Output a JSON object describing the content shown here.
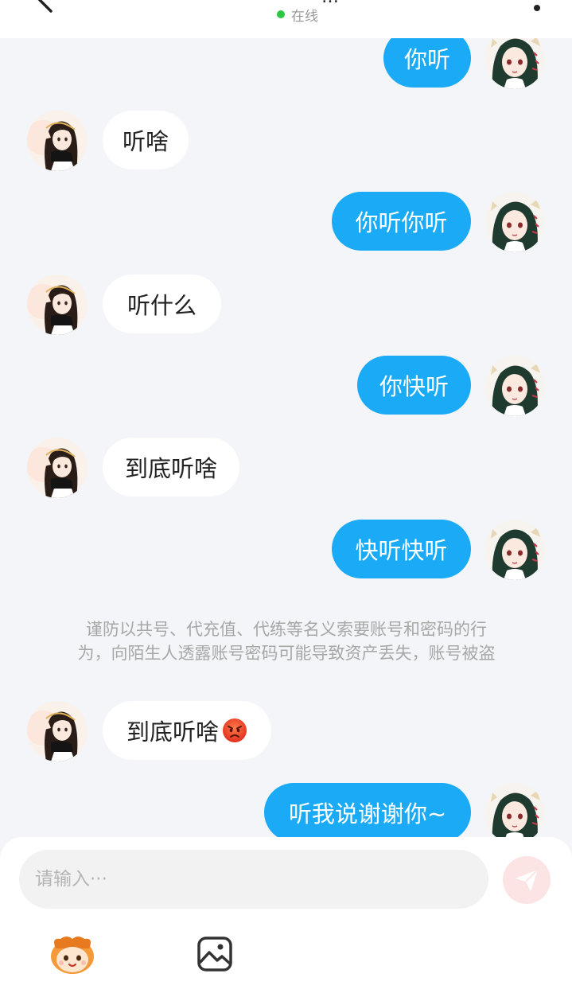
{
  "header": {
    "title": "…",
    "status": "在线"
  },
  "messages": [
    {
      "side": "out",
      "text": "你听"
    },
    {
      "side": "in",
      "text": "听啥"
    },
    {
      "side": "out",
      "text": "你听你听"
    },
    {
      "side": "in",
      "text": "听什么"
    },
    {
      "side": "out",
      "text": "你快听"
    },
    {
      "side": "in",
      "text": "到底听啥"
    },
    {
      "side": "out",
      "text": "快听快听"
    },
    {
      "side": "in",
      "text": "到底听啥",
      "emoji": "angry-face-emoji"
    },
    {
      "side": "out",
      "text": "听我说谢谢你~"
    }
  ],
  "system_notice": {
    "line1": "谨防以共号、代充值、代练等名义索要账号和密码的行",
    "line2": "为，向陌生人透露账号密码可能导致资产丢失，账号被盗"
  },
  "composer": {
    "placeholder": "请输入···",
    "icons": [
      "send-icon",
      "sticker-icon",
      "image-icon"
    ]
  },
  "colors": {
    "outgoing_bubble": "#1aaaf6",
    "incoming_bubble": "#ffffff",
    "background": "#f3f5f8",
    "online_dot": "#28c840",
    "send_button": "#fde4e4"
  }
}
